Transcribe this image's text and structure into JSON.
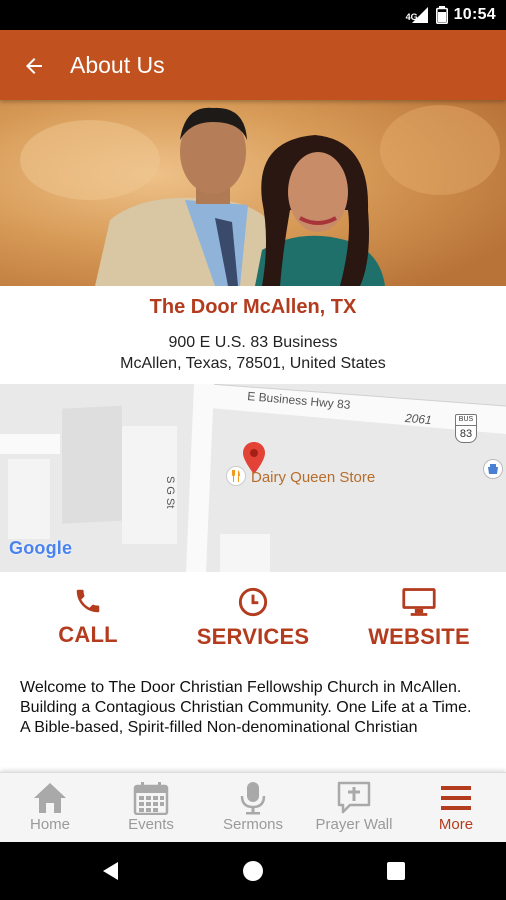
{
  "status_bar": {
    "time": "10:54",
    "network": "4G"
  },
  "app_bar": {
    "title": "About Us"
  },
  "church": {
    "name": "The Door McAllen, TX",
    "address_line1": "900 E U.S. 83 Business",
    "address_line2": "McAllen, Texas, 78501, United States"
  },
  "map": {
    "road_label": "E Business Hwy 83",
    "street_label": "S G St",
    "number_label": "2061",
    "route_shield": "83",
    "route_shield_top": "BUS",
    "poi_label": "Dairy Queen Store",
    "google_logo": "Google"
  },
  "actions": [
    {
      "label": "CALL",
      "icon": "phone-icon"
    },
    {
      "label": "SERVICES",
      "icon": "clock-icon"
    },
    {
      "label": "WEBSITE",
      "icon": "monitor-icon"
    }
  ],
  "description": {
    "line1": "Welcome to The Door Christian Fellowship Church in McAllen.",
    "line2": "Building a Contagious Christian Community. One Life at a Time.",
    "line3": "A Bible-based, Spirit-filled Non-denominational Christian"
  },
  "bottom_nav": [
    {
      "label": "Home",
      "icon": "home-icon",
      "active": false
    },
    {
      "label": "Events",
      "icon": "calendar-icon",
      "active": false
    },
    {
      "label": "Sermons",
      "icon": "microphone-icon",
      "active": false
    },
    {
      "label": "Prayer Wall",
      "icon": "prayer-icon",
      "active": false
    },
    {
      "label": "More",
      "icon": "menu-icon",
      "active": true
    }
  ],
  "colors": {
    "primary": "#c1521f",
    "accent_text": "#b43c1e",
    "inactive": "#9a9a9a"
  }
}
